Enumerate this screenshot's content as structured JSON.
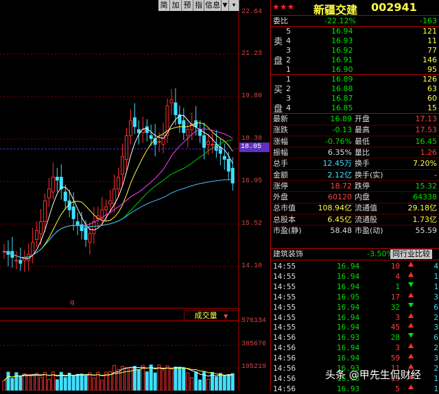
{
  "toolbar": {
    "jian": "简",
    "jia": "加",
    "yu": "预",
    "zhi": "指",
    "xinxi": "信息"
  },
  "axis": {
    "price_ticks": [
      "22.64",
      "21.23",
      "19.80",
      "18.38",
      "16.95",
      "15.52",
      "14.10"
    ],
    "current_price": "18.05",
    "volume_ticks": [
      "576134",
      "385676",
      "195219"
    ]
  },
  "chart": {
    "marker": "q",
    "volume_label": "成交量",
    "colors": {
      "up": "#ff3030",
      "down": "#40e0ff",
      "ma5": "#ffffff",
      "ma10": "#ffff44",
      "ma20": "#ff44ff",
      "ma30": "#00d000",
      "ma60": "#40c0ff",
      "current": "#6030c0"
    }
  },
  "header": {
    "stars": "★★★",
    "name": "新疆交建",
    "code": "002941"
  },
  "order_book": {
    "weibi": {
      "label": "委比",
      "value": "-22.12%",
      "diff": "-163"
    },
    "sell_label": [
      "卖",
      "盘"
    ],
    "buy_label": [
      "买",
      "盘"
    ],
    "sells": [
      {
        "lvl": "5",
        "price": "16.94",
        "vol": "121"
      },
      {
        "lvl": "4",
        "price": "16.93",
        "vol": "11"
      },
      {
        "lvl": "3",
        "price": "16.92",
        "vol": "77"
      },
      {
        "lvl": "2",
        "price": "16.91",
        "vol": "146"
      },
      {
        "lvl": "1",
        "price": "16.90",
        "vol": "95"
      }
    ],
    "buys": [
      {
        "lvl": "1",
        "price": "16.89",
        "vol": "126"
      },
      {
        "lvl": "2",
        "price": "16.88",
        "vol": "63"
      },
      {
        "lvl": "3",
        "price": "16.87",
        "vol": "60"
      },
      {
        "lvl": "4",
        "price": "16.85",
        "vol": "15"
      }
    ]
  },
  "stats": [
    {
      "l1": "最新",
      "v1": "16.89",
      "l2": "开盘",
      "v2": "17.13",
      "c1": "g",
      "c2": "r"
    },
    {
      "l1": "涨跌",
      "v1": "-0.13",
      "l2": "最高",
      "v2": "17.53",
      "c1": "g",
      "c2": "r"
    },
    {
      "l1": "涨幅",
      "v1": "-0.76%",
      "l2": "最低",
      "v2": "16.45",
      "c1": "g",
      "c2": "g"
    },
    {
      "l1": "振幅",
      "v1": "6.35%",
      "l2": "量比",
      "v2": "1.26",
      "c1": "w",
      "c2": "r"
    },
    {
      "l1": "总手",
      "v1": "12.45万",
      "l2": "换手",
      "v2": "7.20%",
      "c1": "c",
      "c2": "y"
    },
    {
      "l1": "金额",
      "v1": "2.12亿",
      "l2": "换手(实)",
      "v2": "-",
      "c1": "c",
      "c2": "w"
    },
    {
      "l1": "涨停",
      "v1": "18.72",
      "l2": "跌停",
      "v2": "15.32",
      "c1": "r",
      "c2": "g"
    },
    {
      "l1": "外盘",
      "v1": "60120",
      "l2": "内盘",
      "v2": "64338",
      "c1": "r",
      "c2": "g"
    },
    {
      "l1": "总市值",
      "v1": "108.94亿",
      "l2": "流通值",
      "v2": "29.18亿",
      "c1": "y",
      "c2": "y"
    },
    {
      "l1": "总股本",
      "v1": "6.45亿",
      "l2": "流通股",
      "v2": "1.73亿",
      "c1": "y",
      "c2": "y"
    },
    {
      "l1": "市盈(静)",
      "v1": "58.48",
      "l2": "市盈(动)",
      "v2": "55.59",
      "c1": "w",
      "c2": "w"
    }
  ],
  "sector": {
    "name": "建筑装饰",
    "change": "-3.50%",
    "button": "同行业比较"
  },
  "ticks": [
    {
      "t": "14:55",
      "p": "16.94",
      "v": "10",
      "d": "up",
      "n": "4"
    },
    {
      "t": "14:55",
      "p": "16.94",
      "v": "4",
      "d": "up",
      "n": "1"
    },
    {
      "t": "14:55",
      "p": "16.94",
      "v": "1",
      "d": "dn",
      "n": "1"
    },
    {
      "t": "14:55",
      "p": "16.95",
      "v": "17",
      "d": "up",
      "n": "3"
    },
    {
      "t": "14:55",
      "p": "16.94",
      "v": "32",
      "d": "dn",
      "n": "6"
    },
    {
      "t": "14:55",
      "p": "16.94",
      "v": "3",
      "d": "up",
      "n": "2"
    },
    {
      "t": "14:55",
      "p": "16.94",
      "v": "45",
      "d": "up",
      "n": "3"
    },
    {
      "t": "14:56",
      "p": "16.93",
      "v": "28",
      "d": "dn",
      "n": "6"
    },
    {
      "t": "14:56",
      "p": "16.94",
      "v": "3",
      "d": "up",
      "n": "2"
    },
    {
      "t": "14:56",
      "p": "16.94",
      "v": "59",
      "d": "up",
      "n": "3"
    },
    {
      "t": "14:56",
      "p": "16.93",
      "v": "11",
      "d": "up",
      "n": "2"
    },
    {
      "t": "14:56",
      "p": "16.93",
      "v": "19",
      "d": "up",
      "n": "1"
    },
    {
      "t": "14:56",
      "p": "16.93",
      "v": "5",
      "d": "up",
      "n": "1"
    }
  ],
  "watermark": "头条 @甲先生侃财经"
}
